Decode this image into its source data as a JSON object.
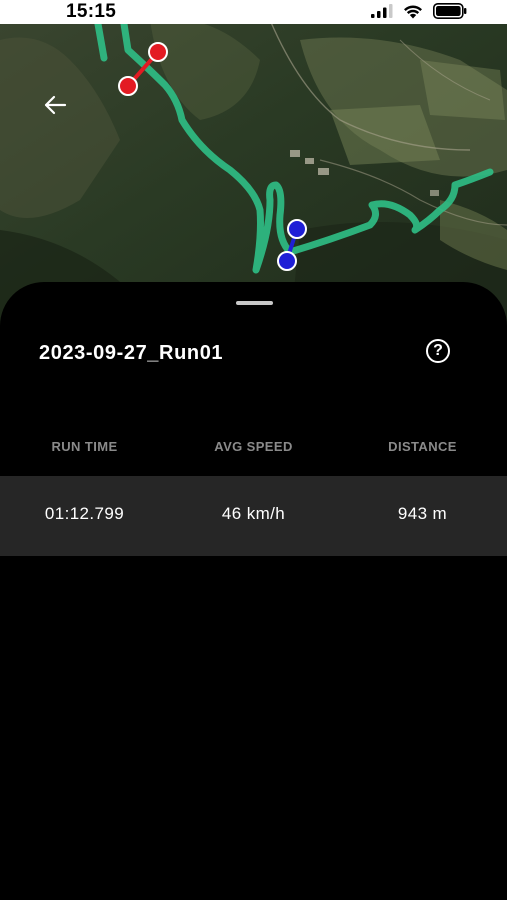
{
  "status_bar": {
    "time": "15:15",
    "icons": [
      "cellular-signal-icon",
      "wifi-icon",
      "battery-icon"
    ]
  },
  "map": {
    "type": "satellite",
    "route_color": "#2fbf86",
    "start_marker_color": "#e31b23",
    "end_marker_color": "#1f1fd6"
  },
  "header": {
    "back_icon": "arrow-left-icon",
    "title": "2023-09-27_Run01",
    "help_icon": "question-circle-icon",
    "help_label": "?"
  },
  "stats": {
    "columns": [
      "RUN TIME",
      "AVG SPEED",
      "DISTANCE"
    ],
    "values": [
      "01:12.799",
      "46 km/h",
      "943 m"
    ]
  }
}
